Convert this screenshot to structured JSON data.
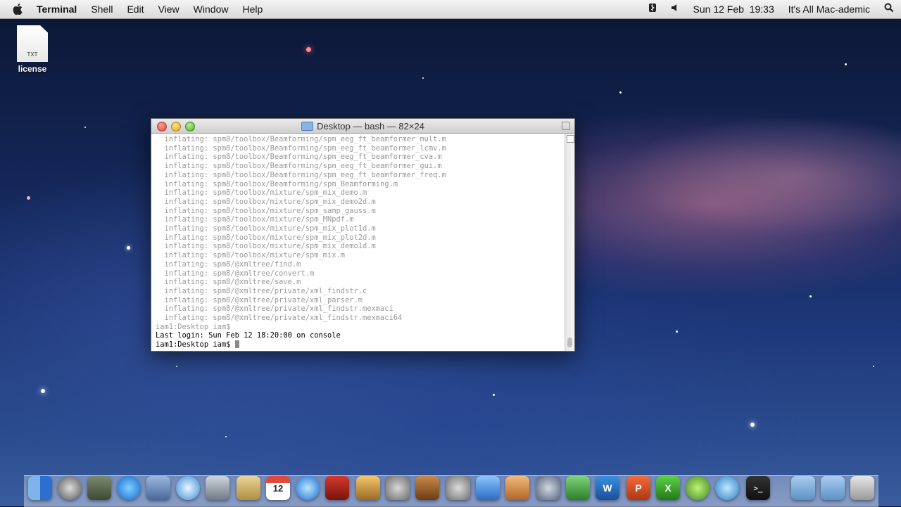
{
  "menubar": {
    "app_name": "Terminal",
    "menus": [
      "Shell",
      "Edit",
      "View",
      "Window",
      "Help"
    ],
    "datetime": "Sun 12 Feb  19:33",
    "user": "It's All Mac-ademic"
  },
  "desktop": {
    "file_badge": "TXT",
    "file_label": "license"
  },
  "window": {
    "title": "Desktop — bash — 82×24"
  },
  "terminal": {
    "lines": [
      "  inflating: spm8/toolbox/Beamforming/spm_eeg_ft_beamformer_mult.m",
      "  inflating: spm8/toolbox/Beamforming/spm_eeg_ft_beamformer_lcmv.m",
      "  inflating: spm8/toolbox/Beamforming/spm_eeg_ft_beamformer_cva.m",
      "  inflating: spm8/toolbox/Beamforming/spm_eeg_ft_beamformer_gui.m",
      "  inflating: spm8/toolbox/Beamforming/spm_eeg_ft_beamformer_freq.m",
      "  inflating: spm8/toolbox/Beamforming/spm_Beamforming.m",
      "  inflating: spm8/toolbox/mixture/spm_mix_demo.m",
      "  inflating: spm8/toolbox/mixture/spm_mix_demo2d.m",
      "  inflating: spm8/toolbox/mixture/spm_samp_gauss.m",
      "  inflating: spm8/toolbox/mixture/spm_MNpdf.m",
      "  inflating: spm8/toolbox/mixture/spm_mix_plot1d.m",
      "  inflating: spm8/toolbox/mixture/spm_mix_plot2d.m",
      "  inflating: spm8/toolbox/mixture/spm_mix_demo1d.m",
      "  inflating: spm8/toolbox/mixture/spm_mix.m",
      "  inflating: spm8/@xmltree/find.m",
      "  inflating: spm8/@xmltree/convert.m",
      "  inflating: spm8/@xmltree/save.m",
      "  inflating: spm8/@xmltree/private/xml_findstr.c",
      "  inflating: spm8/@xmltree/private/xml_parser.m",
      "  inflating: spm8/@xmltree/private/xml_findstr.mexmaci",
      "  inflating: spm8/@xmltree/private/xml_findstr.mexmaci64",
      "iam1:Desktop iam$"
    ],
    "last_login": "Last login: Sun Feb 12 18:20:00 on console",
    "prompt": "iam1:Desktop iam$ "
  },
  "icons": {
    "apple": "apple-icon",
    "volume": "volume-icon",
    "spotlight": "spotlight-icon",
    "bluetooth": "bluetooth-icon"
  }
}
